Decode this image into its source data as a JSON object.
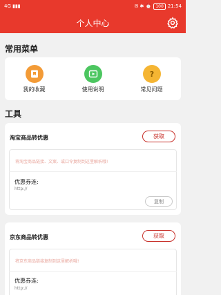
{
  "status_bar": {
    "left": "4G ▮▮▮",
    "right": "✉ ✱ ⏰",
    "battery": "100",
    "time": "21:54"
  },
  "header": {
    "title": "个人中心",
    "settings_icon": "gear-icon",
    "bg": "#e8392c"
  },
  "menu_section": {
    "title": "常用菜单",
    "items": [
      {
        "label": "我的收藏",
        "icon": "bookmark-icon",
        "color": "#f39b37"
      },
      {
        "label": "使用说明",
        "icon": "play-icon",
        "color": "#4cc660"
      },
      {
        "label": "常见问题",
        "icon": "question-icon",
        "color": "#f5b533"
      }
    ]
  },
  "tools_section": {
    "title": "工具",
    "cards": [
      {
        "title": "淘宝商品转优惠",
        "get_label": "获取",
        "paste_hint": "将淘宝商品链接、文案、或口令复制到这里解析哦!",
        "coupon_label": "优惠券连:",
        "coupon_value": "http://",
        "copy_label": "复制"
      },
      {
        "title": "京东商品转优惠",
        "get_label": "获取",
        "paste_hint": "将京东商品链接复制到这里解析哦!",
        "coupon_label": "优惠券连:",
        "coupon_value": "http://"
      }
    ]
  }
}
